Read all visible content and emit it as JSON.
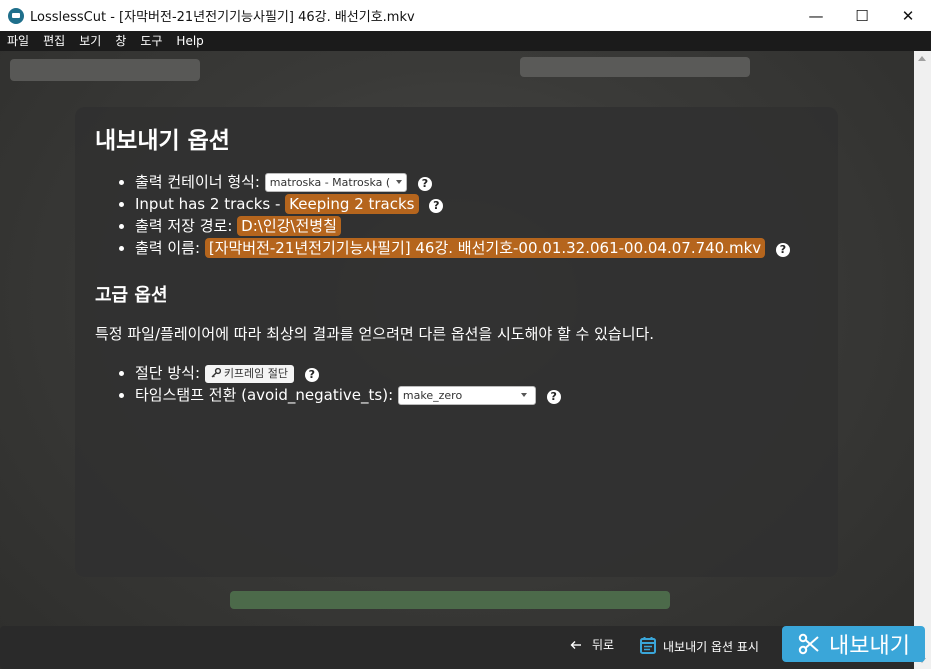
{
  "window": {
    "title": "LosslessCut - [자막버전-21년전기기능사필기] 46강. 배선기호.mkv",
    "minimize": "—",
    "maximize": "☐",
    "close": "✕"
  },
  "menu": [
    "파일",
    "편집",
    "보기",
    "창",
    "도구",
    "Help"
  ],
  "dialog": {
    "title": "내보내기 옵션",
    "container_label": "출력 컨테이너 형식:",
    "container_value": "matroska - Matroska (",
    "tracks_prefix": "Input has 2 tracks -",
    "tracks_value": "Keeping 2 tracks",
    "path_label": "출력 저장 경로:",
    "path_value": "D:\\인강\\전병칠",
    "name_label": "출력 이름:",
    "name_value": "[자막버전-21년전기기능사필기] 46강. 배선기호-00.01.32.061-00.04.07.740.mkv",
    "advanced_title": "고급 옵션",
    "advanced_desc": "특정 파일/플레이어에 따라 최상의 결과를 얻으려면 다른 옵션을 시도해야 할 수 있습니다.",
    "cut_mode_label": "절단 방식:",
    "cut_mode_value": "키프레임 절단",
    "timestamp_label": "타임스탬프 전환 (avoid_negative_ts):",
    "timestamp_value": "make_zero",
    "help_glyph": "?"
  },
  "bottom": {
    "back_label": "뒤로",
    "show_options_label": "내보내기 옵션 표시",
    "export_label": "내보내기"
  },
  "colors": {
    "highlight": "#b5651d",
    "export_button": "#3aa6d9"
  }
}
